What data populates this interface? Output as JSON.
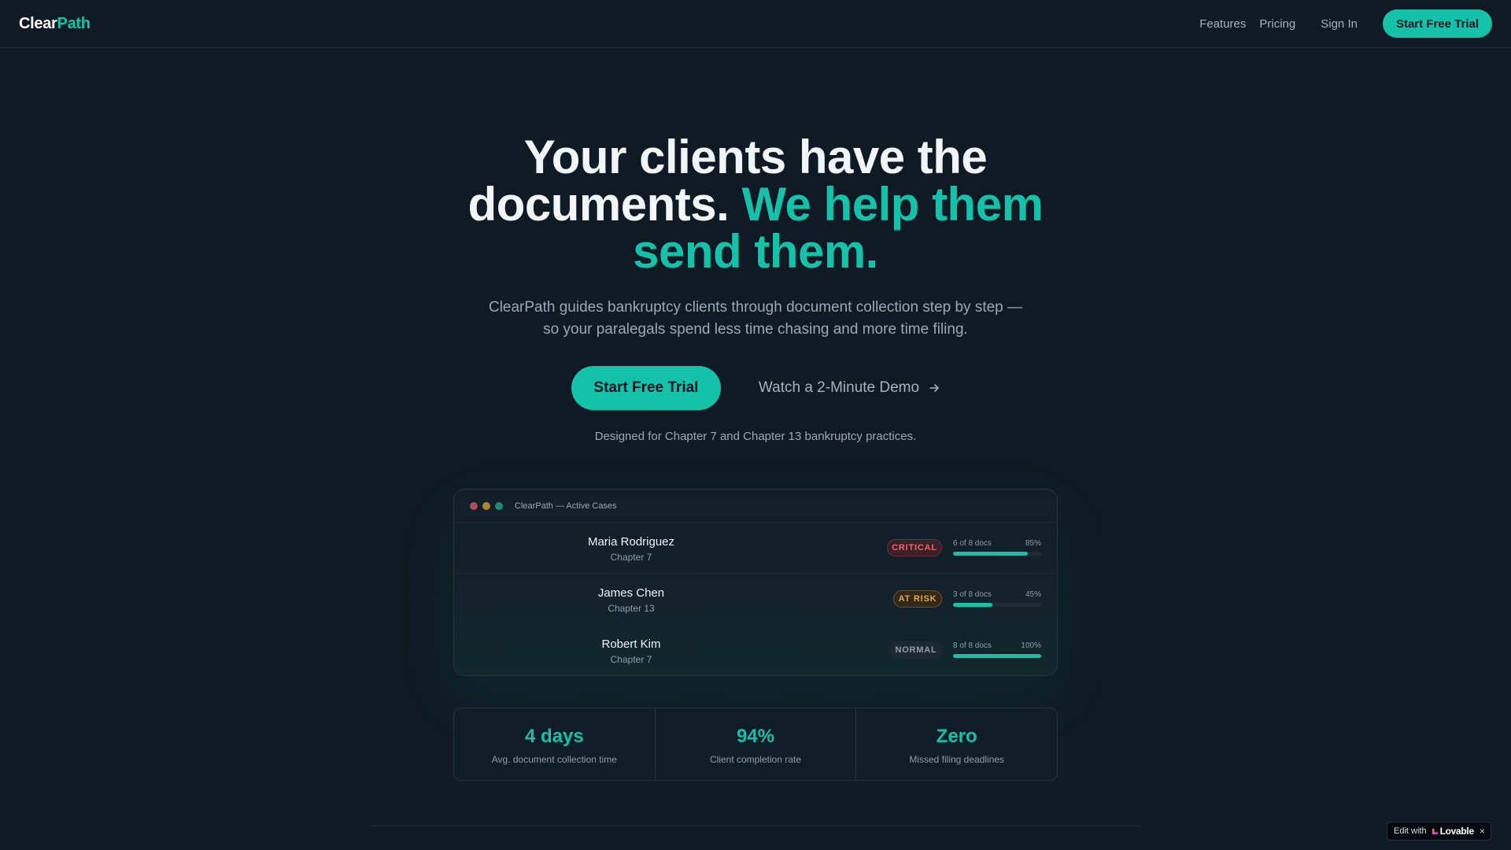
{
  "nav": {
    "logo_part1": "Clear",
    "logo_part2": "Path",
    "links": [
      "Features",
      "Pricing"
    ],
    "sign_in": "Sign In",
    "cta": "Start Free Trial"
  },
  "hero": {
    "title_line1": "Your clients have the",
    "title_line2_plain": "documents.",
    "title_line2_accent": "We help them",
    "title_line3_accent": "send them.",
    "subtitle": "ClearPath guides bankruptcy clients through document collection step by step — so your paralegals spend less time chasing and more time filing.",
    "primary_cta": "Start Free Trial",
    "secondary_cta": "Watch a 2-Minute Demo",
    "designed_for": "Designed for Chapter 7 and Chapter 13 bankruptcy practices."
  },
  "dashboard": {
    "window_title": "ClearPath — Active Cases",
    "cases": [
      {
        "name": "Maria Rodriguez",
        "chapter": "Chapter 7",
        "status": "CRITICAL",
        "docs": "6 of 8 docs",
        "percent_label": "85%",
        "progress": 0.85
      },
      {
        "name": "James Chen",
        "chapter": "Chapter 13",
        "status": "AT RISK",
        "docs": "3 of 8 docs",
        "percent_label": "45%",
        "progress": 0.45
      },
      {
        "name": "Robert Kim",
        "chapter": "Chapter 7",
        "status": "NORMAL",
        "docs": "8 of 8 docs",
        "percent_label": "100%",
        "progress": 1.0
      }
    ]
  },
  "stats": [
    {
      "value": "4 days",
      "label": "Avg. document collection time"
    },
    {
      "value": "94%",
      "label": "Client completion rate"
    },
    {
      "value": "Zero",
      "label": "Missed filing deadlines"
    }
  ],
  "lovable": {
    "prefix": "Edit with",
    "brand": "Lovable",
    "close": "×"
  },
  "colors": {
    "background": "#0f1a25",
    "accent": "#14c2a9",
    "critical": "#f0646d",
    "at_risk": "#e7a43a",
    "normal": "#8e9cab"
  }
}
